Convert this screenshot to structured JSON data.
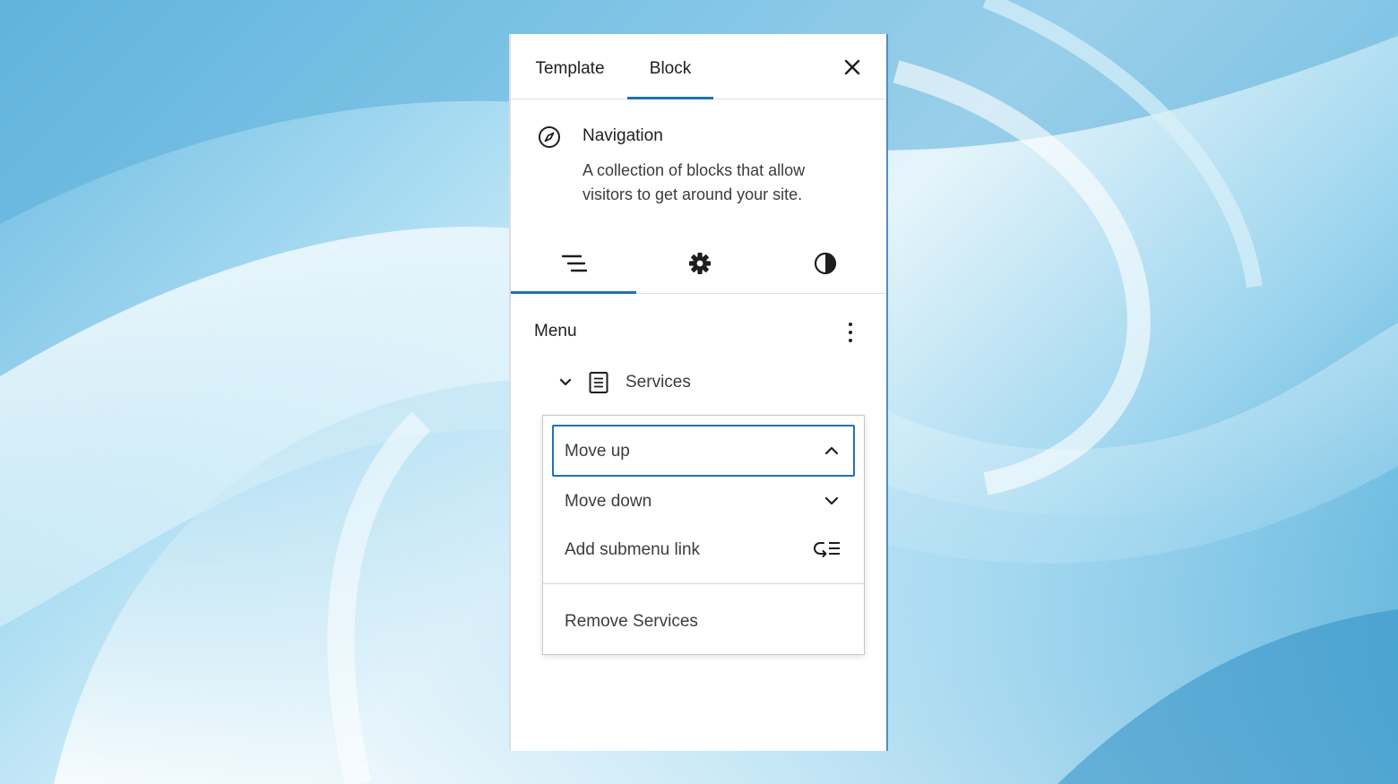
{
  "tabs": [
    {
      "label": "Template",
      "active": false
    },
    {
      "label": "Block",
      "active": true
    }
  ],
  "close_icon": "close-icon",
  "block": {
    "icon": "compass-icon",
    "title": "Navigation",
    "description": "A collection of blocks that allow visitors to get around your site."
  },
  "settings_tabs": [
    {
      "icon": "list-view-icon",
      "active": true
    },
    {
      "icon": "gear-icon",
      "active": false
    },
    {
      "icon": "contrast-icon",
      "active": false
    }
  ],
  "menu": {
    "label": "Menu",
    "options_icon": "more-vertical-icon",
    "items": [
      {
        "label": "Services",
        "icon": "page-icon",
        "expanded": true
      }
    ]
  },
  "dropdown": {
    "items": [
      {
        "label": "Move up",
        "icon": "chevron-up-icon",
        "focused": true
      },
      {
        "label": "Move down",
        "icon": "chevron-down-icon"
      },
      {
        "label": "Add submenu link",
        "icon": "add-submenu-icon"
      }
    ],
    "remove_label": "Remove Services"
  },
  "colors": {
    "accent": "#2271b1",
    "text": "#1e1e1e",
    "muted_text": "#3c3c3c"
  }
}
